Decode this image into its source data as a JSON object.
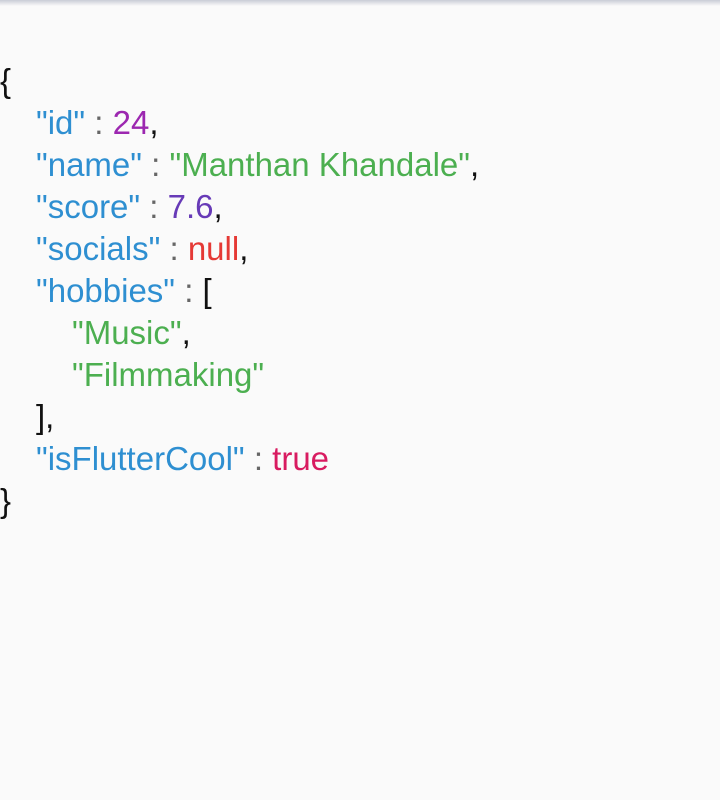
{
  "colors": {
    "key": "#2e8fd1",
    "string": "#4caf50",
    "int": "#9c27b0",
    "double": "#673ab7",
    "null": "#e53935",
    "bool": "#d81b60",
    "punctuation": "#111111",
    "separator": "#666666",
    "background": "#fafafa"
  },
  "json": {
    "open_brace": "{",
    "close_brace": "}",
    "separator": " : ",
    "comma": ",",
    "open_bracket": "[",
    "close_bracket_comma": "],",
    "entries": {
      "id": {
        "key": "\"id\"",
        "value": "24"
      },
      "name": {
        "key": "\"name\"",
        "value": "\"Manthan Khandale\""
      },
      "score": {
        "key": "\"score\"",
        "value": "7.6"
      },
      "socials": {
        "key": "\"socials\"",
        "value": "null"
      },
      "hobbies": {
        "key": "\"hobbies\"",
        "items": [
          "\"Music\"",
          "\"Filmmaking\""
        ]
      },
      "isFlutterCool": {
        "key": "\"isFlutterCool\"",
        "value": "true"
      }
    }
  }
}
